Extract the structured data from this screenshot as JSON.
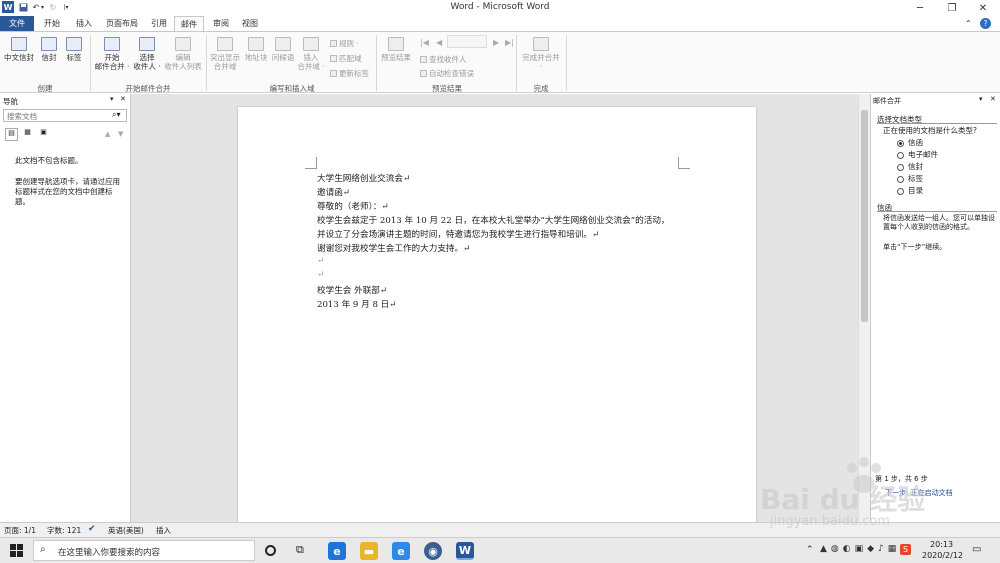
{
  "window": {
    "title": "Word - Microsoft Word",
    "app_icon": "W"
  },
  "quick_access": {
    "save": "save-icon",
    "undo": "undo-icon",
    "redo": "redo-icon",
    "customize": "customize-icon"
  },
  "tabs": [
    "文件",
    "开始",
    "插入",
    "页面布局",
    "引用",
    "邮件",
    "审阅",
    "视图"
  ],
  "ribbon": {
    "create": {
      "chinese_envelope": "中文信封",
      "envelope": "信封",
      "label": "标签",
      "group": "创建"
    },
    "start_merge": {
      "start_l1": "开始",
      "start_l2": "邮件合并 ·",
      "select_l1": "选择",
      "select_l2": "收件人 ·",
      "edit_l1": "编辑",
      "edit_l2": "收件人列表",
      "group": "开始邮件合并"
    },
    "write_insert": {
      "highlight_l1": "突出显示",
      "highlight_l2": "合并域",
      "address": "地址块",
      "greeting": "问候语",
      "insert_l1": "插入",
      "insert_l2": "合并域 ·",
      "rules": "规则 ·",
      "match": "匹配域",
      "update": "更新标签",
      "group": "编写和插入域"
    },
    "preview": {
      "preview": "预览结果",
      "find": "查找收件人",
      "auto_check": "自动检查错误",
      "group": "预览结果"
    },
    "finish": {
      "finish_l1": "完成并合并",
      "finish_l2": "·",
      "group": "完成"
    }
  },
  "nav_pane": {
    "title": "导航",
    "search_placeholder": "搜索文档",
    "msg1": "此文档不包含标题。",
    "msg2": "要创建导航选项卡，请通过应用标题样式在您的文档中创建标题。"
  },
  "document": {
    "lines": [
      "大学生网络创业交流会↵",
      "邀请函↵",
      "尊敬的（老师）：↵",
      "校学生会兹定于 2013 年 10 月 22 日，在本校大礼堂举办“大学生网络创业交流会”的活动，",
      "并设立了分会场演讲主题的时间，特邀请您为我校学生进行指导和培训。↵",
      "谢谢您对我校学生会工作的大力支持。↵",
      "↵",
      "↵",
      "校学生会 外联部↵",
      "2013 年 9 月 8 日↵"
    ]
  },
  "mail_merge_pane": {
    "title": "邮件合并",
    "section": "选择文档类型",
    "question": "正在使用的文档是什么类型?",
    "options": [
      "信函",
      "电子邮件",
      "信封",
      "标签",
      "目录"
    ],
    "selected": "信函",
    "info_title": "信函",
    "info_text": "将信函发送给一组人。您可以单独设置每个人收到的信函的格式。",
    "next_hint": "单击“下一步”继续。",
    "step": "第 1 步，共 6 步",
    "next_link": "下一步: 正在启动文档"
  },
  "status_bar": {
    "page": "页面: 1/1",
    "words": "字数: 121",
    "lang": "英语(美国)",
    "mode": "插入"
  },
  "taskbar": {
    "search_placeholder": "在这里输入你要搜索的内容",
    "time": "20:13",
    "date": "2020/2/12"
  },
  "watermark": {
    "brand": "Bai du 经验",
    "url": "jingyan.baidu.com"
  },
  "colors": {
    "file_tab": "#2b579a",
    "word_icon": "#2b579a"
  }
}
